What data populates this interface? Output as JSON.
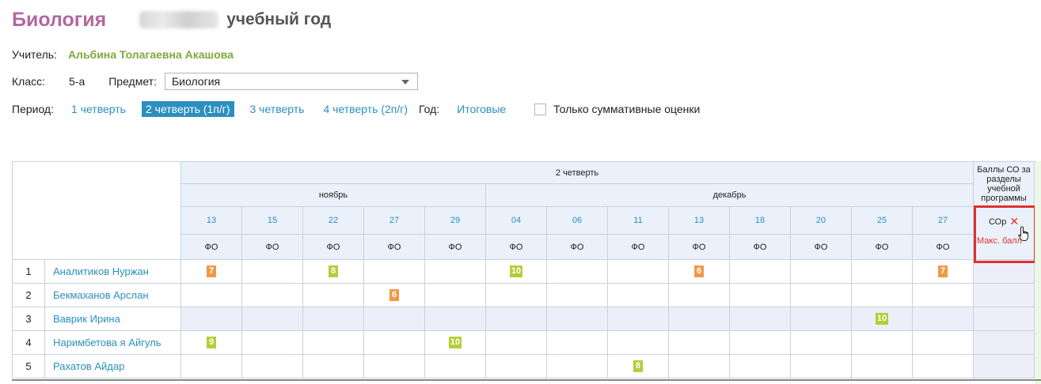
{
  "header": {
    "subject": "Биология",
    "year_suffix": "учебный год"
  },
  "teacher": {
    "label": "Учитель:",
    "name": "Альбина Толагаевна Акашова"
  },
  "class_row": {
    "label": "Класс:",
    "value": "5-а",
    "subject_label": "Предмет:",
    "subject_value": "Биология"
  },
  "period": {
    "label": "Период:",
    "options": [
      "1 четверть",
      "2 четверть (1п/г)",
      "3 четверть",
      "4 четверть (2п/г)"
    ],
    "year_label": "Год:",
    "final_link": "Итоговые",
    "checkbox_label": "Только суммативные оценки"
  },
  "table": {
    "quarter": "2 четверть",
    "months": [
      "ноябрь",
      "декабрь"
    ],
    "dates": [
      "13",
      "15",
      "22",
      "27",
      "29",
      "04",
      "06",
      "11",
      "13",
      "18",
      "20",
      "25",
      "27"
    ],
    "type_label": "ФО",
    "co_header": "Баллы СО за разделы учебной программы",
    "cop_label": "СОр",
    "cop_remove": "✕",
    "max_label": "Макс. балл",
    "students": [
      {
        "n": "1",
        "name": "Аналитиков Нуржан",
        "marks": [
          "7",
          "",
          "8",
          "",
          "",
          "10",
          "",
          "",
          "6",
          "",
          "",
          "",
          "7"
        ]
      },
      {
        "n": "2",
        "name": "Бекмаханов Арслан",
        "marks": [
          "",
          "",
          "",
          "6",
          "",
          "",
          "",
          "",
          "",
          "",
          "",
          "",
          ""
        ]
      },
      {
        "n": "3",
        "name": "Ваврик Ирина",
        "marks": [
          "",
          "",
          "",
          "",
          "",
          "",
          "",
          "",
          "",
          "",
          "",
          "10",
          ""
        ]
      },
      {
        "n": "4",
        "name": "Наримбетова я Айгуль",
        "marks": [
          "9",
          "",
          "",
          "",
          "10",
          "",
          "",
          "",
          "",
          "",
          "",
          "",
          ""
        ]
      },
      {
        "n": "5",
        "name": "Рахатов Айдар",
        "marks": [
          "",
          "",
          "",
          "",
          "",
          "",
          "",
          "8",
          "",
          "",
          "",
          "",
          ""
        ]
      }
    ],
    "mark_colors": {
      "orange": "#ef9a47",
      "green": "#b5cd3a"
    },
    "mark_color_map": {
      "0-0": "orange",
      "0-2": "green",
      "0-5": "green",
      "0-8": "orange",
      "0-12": "orange",
      "1-3": "orange",
      "2-11": "green",
      "3-0": "green",
      "3-4": "green",
      "4-7": "green"
    }
  },
  "colors": {
    "subject_title": "#b4679e",
    "teacher_name": "#7fa83b",
    "link": "#2b8fbf",
    "accent_red": "#e0312c"
  }
}
